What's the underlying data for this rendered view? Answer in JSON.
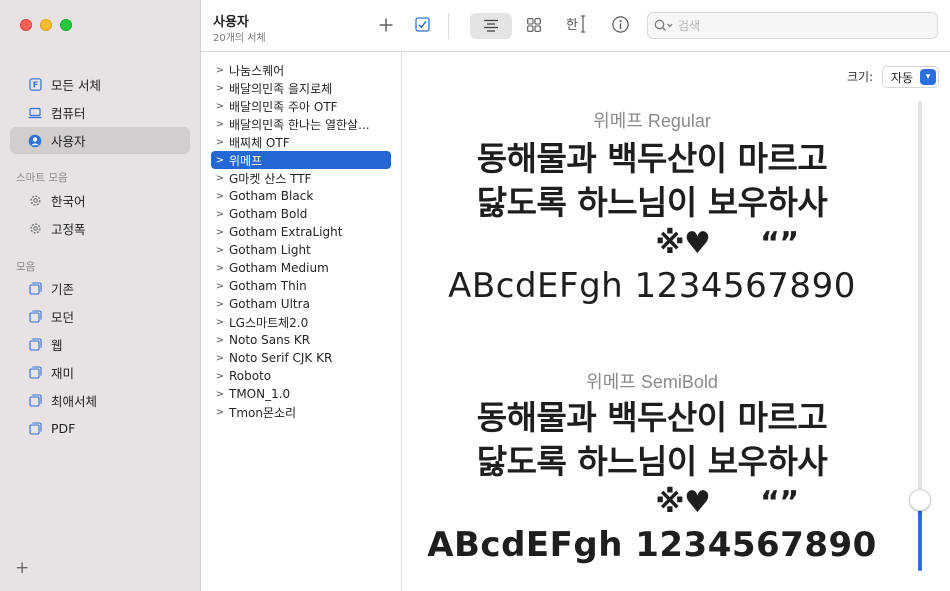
{
  "sidebar": {
    "library_items": [
      {
        "label": "모든 서체",
        "icon": "font-book-icon"
      },
      {
        "label": "컴퓨터",
        "icon": "laptop-icon"
      },
      {
        "label": "사용자",
        "icon": "user-circle-icon",
        "selected": true
      }
    ],
    "smart_collections_header": "스마트 모음",
    "smart_items": [
      {
        "label": "한국어",
        "icon": "gear-icon"
      },
      {
        "label": "고정폭",
        "icon": "gear-icon"
      }
    ],
    "collections_header": "모음",
    "collection_items": [
      {
        "label": "기존",
        "icon": "collection-icon"
      },
      {
        "label": "모던",
        "icon": "collection-icon"
      },
      {
        "label": "웹",
        "icon": "collection-icon"
      },
      {
        "label": "재미",
        "icon": "collection-icon"
      },
      {
        "label": "최애서체",
        "icon": "collection-icon"
      },
      {
        "label": "PDF",
        "icon": "collection-icon"
      }
    ],
    "add_label": "+"
  },
  "toolbar": {
    "title": "사용자",
    "subtitle": "20개의 서체",
    "search_placeholder": "검색",
    "add_icon": "plus-icon",
    "activate_icon": "checkbox-icon"
  },
  "font_list": [
    {
      "label": "나눔스퀘어"
    },
    {
      "label": "배달의민족 을지로체"
    },
    {
      "label": "배달의민족 주아 OTF"
    },
    {
      "label": "배달의민족 한나는 열한살..."
    },
    {
      "label": "배찌체 OTF"
    },
    {
      "label": "위메프",
      "selected": true
    },
    {
      "label": "G마켓 산스 TTF"
    },
    {
      "label": "Gotham Black"
    },
    {
      "label": "Gotham Bold"
    },
    {
      "label": "Gotham ExtraLight"
    },
    {
      "label": "Gotham Light"
    },
    {
      "label": "Gotham Medium"
    },
    {
      "label": "Gotham Thin"
    },
    {
      "label": "Gotham Ultra"
    },
    {
      "label": "LG스마트체2.0"
    },
    {
      "label": "Noto Sans KR"
    },
    {
      "label": "Noto Serif CJK KR"
    },
    {
      "label": "Roboto"
    },
    {
      "label": "TMON_1.0"
    },
    {
      "label": "Tmon몬소리"
    }
  ],
  "preview": {
    "size_label": "크기:",
    "size_value": "자동",
    "slider_value_fraction": 0.15,
    "samples": [
      {
        "font_name": "위메프 Regular",
        "line1": "동해물과 백두산이 마르고",
        "line2": "닳도록 하느님이 보우하사",
        "line3": "※♥     “”",
        "line4": "ABcdEFgh 1234567890"
      },
      {
        "font_name": "위메프 SemiBold",
        "line1": "동해물과 백두산이 마르고",
        "line2": "닳도록 하느님이 보우하사",
        "line3": "※♥     “”",
        "line4": "ABcdEFgh 1234567890"
      }
    ]
  },
  "colors": {
    "accent": "#2468d5",
    "sidebar_bg": "#e9e2e3",
    "sidebar_selected": "#d3cdcd"
  }
}
